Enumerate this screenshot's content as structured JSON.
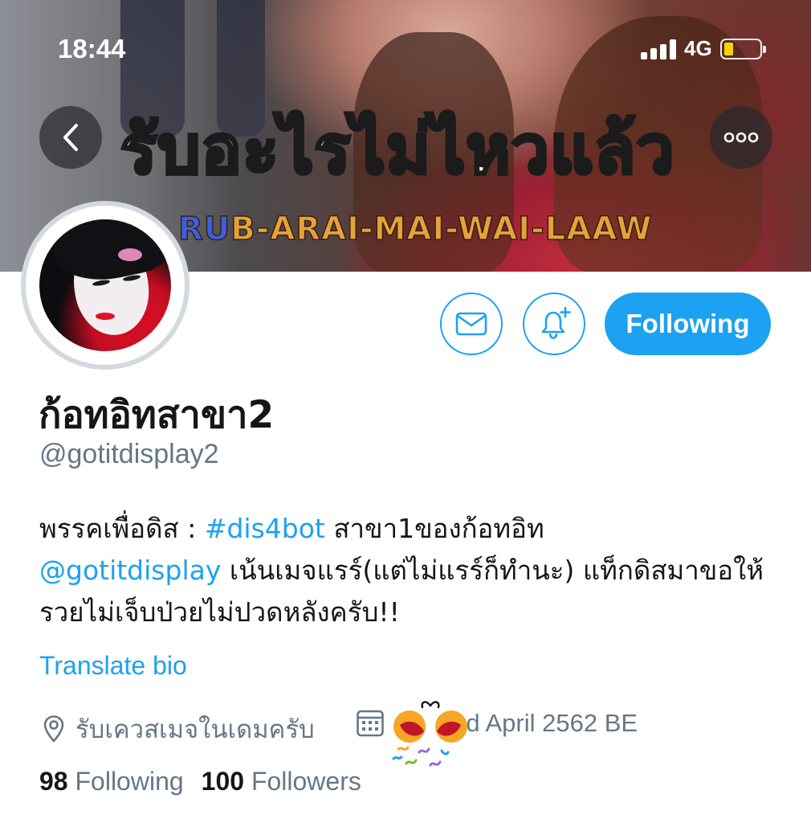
{
  "status_bar": {
    "time": "18:44",
    "network": "4G",
    "battery_level": 0.2,
    "signal_bars": 4
  },
  "banner": {
    "lyric_thai": "รับอะไรไม่ไหวแล้ว",
    "lyric_roman_highlight": "RU",
    "lyric_roman_rest": "B-ARAI-MAI-WAI-LAAW"
  },
  "nav": {
    "back_icon": "chevron-left-icon",
    "more_icon": "more-horizontal-icon"
  },
  "actions": {
    "message_icon": "envelope-icon",
    "notify_icon": "bell-plus-icon",
    "following_label": "Following"
  },
  "profile": {
    "display_name": "ก้อทอิทสาขา2",
    "handle": "@gotitdisplay2",
    "bio": {
      "part1": "พรรคเพื่อดิส : ",
      "hashtag": "#dis4bot",
      "part2": " สาขา1ของก้อทอิท",
      "mention": "@gotitdisplay",
      "part3": " เน้นเมจแรร์(แต่ไม่แรร์ก็ทำนะ) แท็กดิสมาขอให้รวยไม่เจ็บป่วยไม่ปวดหลังครับ!!"
    },
    "translate_label": "Translate bio",
    "location": "รับเควสเมจในเดมครับ",
    "joined_prefix": "Joined",
    "joined_visible_suffix": "d April 2562 BE",
    "following_count": "98",
    "following_label": "Following",
    "followers_count": "100",
    "followers_label": "Followers"
  },
  "colors": {
    "accent": "#1da1f2",
    "secondary_text": "#657786",
    "primary_text": "#14171a"
  }
}
